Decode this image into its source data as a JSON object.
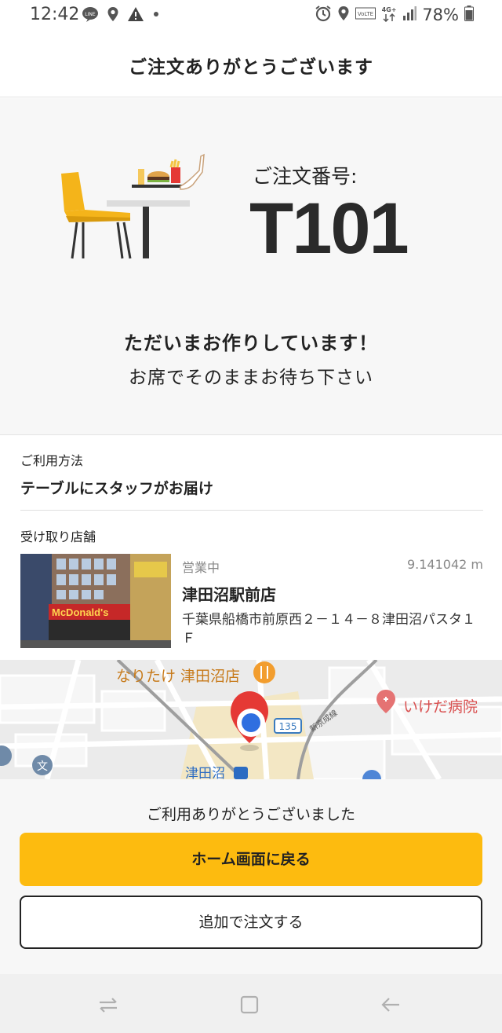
{
  "status_bar": {
    "time": "12:42",
    "line_icon": "LINE",
    "volte": "VoLTE",
    "network": "4G+",
    "battery": "78%"
  },
  "header": {
    "title": "ご注文ありがとうございます"
  },
  "order": {
    "label": "ご注文番号:",
    "number": "T101",
    "status_main": "ただいまお作りしています！",
    "status_sub": "お席でそのままお待ち下さい"
  },
  "usage": {
    "label": "ご利用方法",
    "value": "テーブルにスタッフがお届け"
  },
  "store": {
    "label": "受け取り店舗",
    "status": "営業中",
    "distance": "9.141042 m",
    "name": "津田沼駅前店",
    "address": "千葉県船橋市前原西２－１４－８津田沼パスタ１Ｆ",
    "photo_sign": "McDonald's"
  },
  "map": {
    "poi_restaurant": "なりたけ 津田沼店",
    "poi_hospital": "いけだ病院",
    "route_number": "135",
    "rail_line": "新京成線",
    "station": "津田沼",
    "map_icon_text": "文"
  },
  "footer": {
    "thanks": "ご利用ありがとうございました",
    "home_button": "ホーム画面に戻る",
    "order_more_button": "追加で注文する"
  },
  "colors": {
    "accent": "#fdbb0f",
    "chair": "#f4b41a",
    "pin": "#e53935",
    "location_dot": "#2f6fe0"
  }
}
